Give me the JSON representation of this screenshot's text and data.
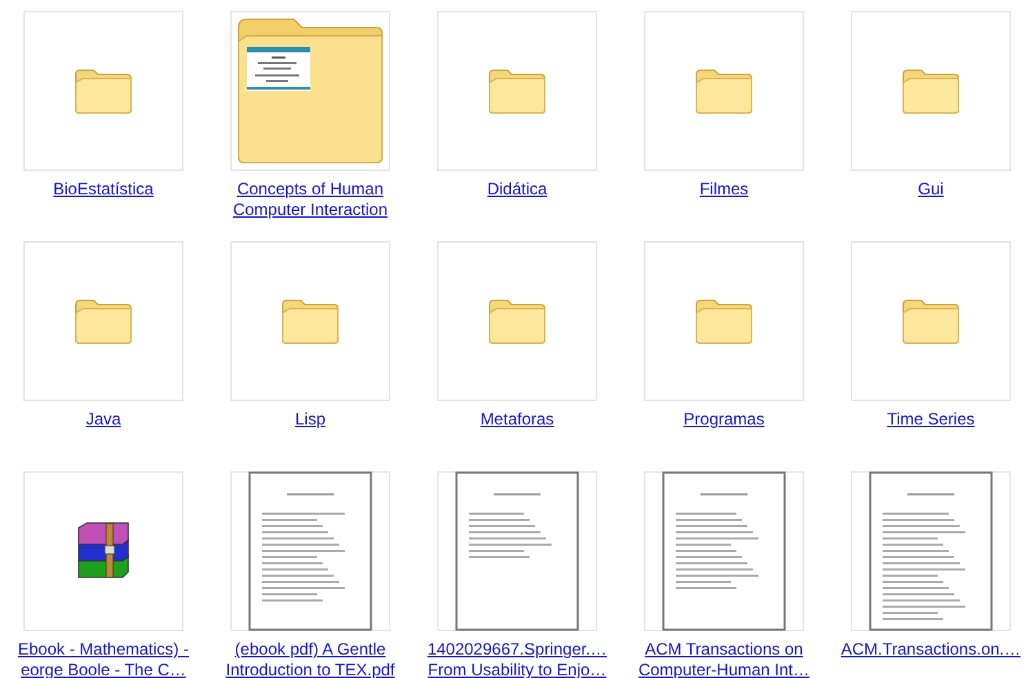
{
  "items": [
    {
      "kind": "folder",
      "lines": [
        "BioEstatística"
      ]
    },
    {
      "kind": "folder-preview",
      "lines": [
        "Concepts of Human",
        "Computer Interaction"
      ]
    },
    {
      "kind": "folder",
      "lines": [
        "Didática"
      ]
    },
    {
      "kind": "folder",
      "lines": [
        "Filmes"
      ]
    },
    {
      "kind": "folder",
      "lines": [
        "Gui"
      ]
    },
    {
      "kind": "folder",
      "lines": [
        "Java"
      ]
    },
    {
      "kind": "folder",
      "lines": [
        "Lisp"
      ]
    },
    {
      "kind": "folder",
      "lines": [
        "Metaforas"
      ]
    },
    {
      "kind": "folder",
      "lines": [
        "Programas"
      ]
    },
    {
      "kind": "folder",
      "lines": [
        "Time Series"
      ]
    },
    {
      "kind": "archive",
      "lines": [
        "Ebook - Mathematics) -",
        "eorge Boole - The C…"
      ]
    },
    {
      "kind": "document",
      "lines": [
        "(ebook pdf) A Gentle",
        "Introduction to TEX.pdf"
      ]
    },
    {
      "kind": "document",
      "lines": [
        "1402029667.Springer.…",
        "From Usability to Enjo…"
      ]
    },
    {
      "kind": "document",
      "lines": [
        "ACM Transactions on",
        "Computer-Human Int…"
      ]
    },
    {
      "kind": "document",
      "lines": [
        "ACM.Transactions.on.…"
      ]
    }
  ]
}
